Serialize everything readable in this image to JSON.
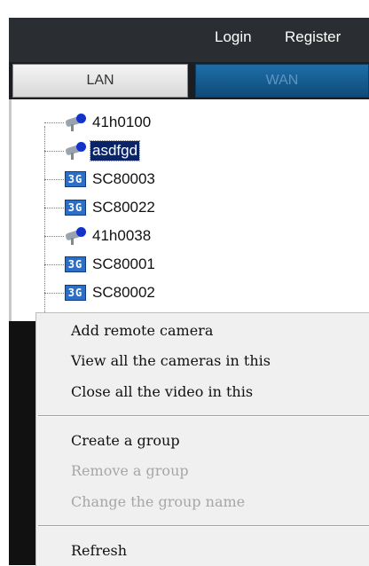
{
  "header": {
    "login": "Login",
    "register": "Register"
  },
  "tabs": [
    {
      "label": "LAN"
    },
    {
      "label": "WAN"
    }
  ],
  "tree": {
    "items": [
      {
        "label": "41h0100",
        "icon": "camera-icon"
      },
      {
        "label": "asdfgd",
        "icon": "camera-icon",
        "selected": true
      },
      {
        "label": "SC80003",
        "icon": "3g-device-icon"
      },
      {
        "label": "SC80022",
        "icon": "3g-device-icon"
      },
      {
        "label": "41h0038",
        "icon": "camera-icon"
      },
      {
        "label": "SC80001",
        "icon": "3g-device-icon"
      },
      {
        "label": "SC80002",
        "icon": "3g-device-icon"
      }
    ],
    "icon_3g_text": "3G"
  },
  "context_menu": {
    "items": [
      {
        "label": "Add remote camera",
        "enabled": true
      },
      {
        "label": "View all the cameras in this",
        "enabled": true
      },
      {
        "label": "Close all the video in this",
        "enabled": true
      },
      {
        "label": "Create a group",
        "enabled": true
      },
      {
        "label": "Remove a group",
        "enabled": false
      },
      {
        "label": "Change the group name",
        "enabled": false
      },
      {
        "label": "Refresh",
        "enabled": true
      }
    ]
  },
  "colors": {
    "header_bg": "#2a2d32",
    "wan_tab": "#1d6ea7",
    "selection": "#0a246a",
    "icon_3g": "#2d6fc7"
  }
}
